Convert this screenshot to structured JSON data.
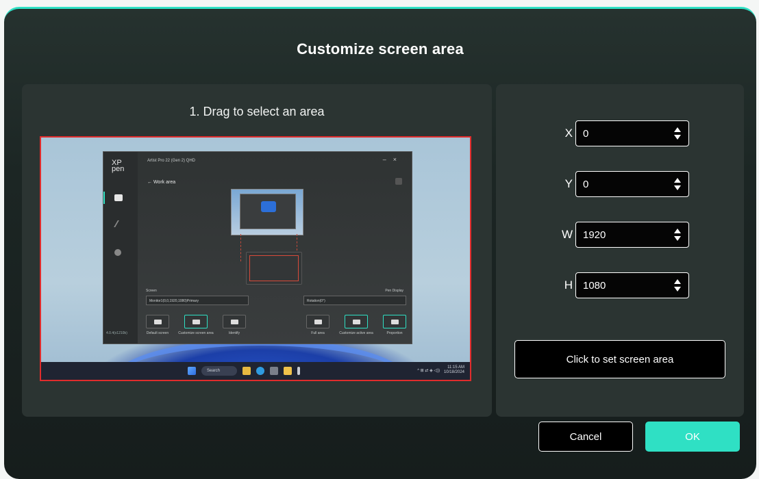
{
  "dialog": {
    "title": "Customize screen area",
    "accent_color": "#2fe0c4"
  },
  "left_panel": {
    "instruction": "1. Drag to select an area",
    "selection_border_color": "#e12c2c",
    "preview": {
      "app_window": {
        "logo": "XP\npen",
        "title": "Artist Pro 22 (Gen 2) QHD",
        "back_label": "Work area",
        "screen_label": "Screen",
        "pen_display_label": "Pen Display",
        "monitor_select": "Monitor1(0,0,1920,1080)Primary",
        "rotation_select": "Rotation(0°)",
        "left_buttons": [
          "Default screen",
          "Customize screen area",
          "Identify"
        ],
        "right_buttons": [
          "Full area",
          "Customize active area",
          "Proportion"
        ],
        "version": "4.0.4(x1210b)",
        "nav_icons": [
          "tablet-icon",
          "pen-icon",
          "gear-icon"
        ]
      },
      "taskbar": {
        "search_placeholder": "Search",
        "clock_time": "11:15 AM",
        "clock_date": "10/18/2024"
      }
    }
  },
  "right_panel": {
    "fields": [
      {
        "label": "X",
        "value": "0"
      },
      {
        "label": "Y",
        "value": "0"
      },
      {
        "label": "W",
        "value": "1920"
      },
      {
        "label": "H",
        "value": "1080"
      }
    ],
    "set_button": "Click to set screen area"
  },
  "footer": {
    "cancel": "Cancel",
    "ok": "OK"
  }
}
